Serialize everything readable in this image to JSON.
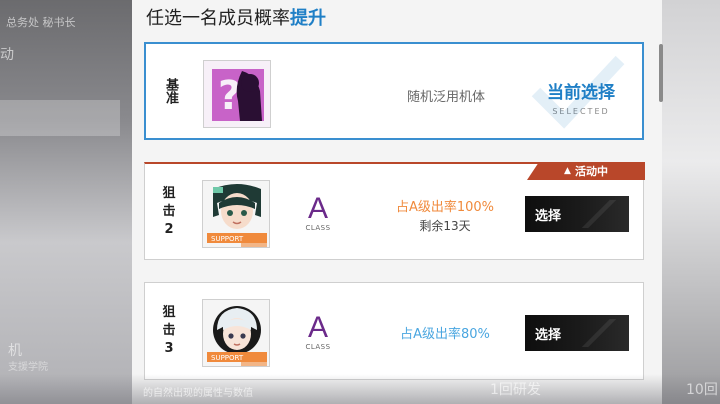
{
  "background": {
    "left_text_1": "总务处 秘书长",
    "left_text_2": "动",
    "left_text_3": "机",
    "left_text_4": "支援学院",
    "bottom_text_1": "的自然出现的属性与数值",
    "bottom_text_2": "1回研发",
    "bottom_text_3": "10回"
  },
  "panel": {
    "title_prefix": "任选一名成员概率",
    "title_highlight": "提升"
  },
  "cards": [
    {
      "tier": "基准",
      "description": "随机泛用机体",
      "status_cn": "当前选择",
      "status_en": "SELECTED"
    },
    {
      "tier": "狙击2",
      "tier_line1": "狙",
      "tier_line2": "击",
      "tier_line3": "2",
      "class_letter": "A",
      "class_label": "CLASS",
      "rate_text": "占A级出率100%",
      "remaining": "剩余13天",
      "badge_text": "活动中",
      "button": "选择"
    },
    {
      "tier_line1": "狙",
      "tier_line2": "击",
      "tier_line3": "3",
      "class_letter": "A",
      "class_label": "CLASS",
      "rate_text": "占A级出率80%",
      "button": "选择"
    }
  ],
  "colors": {
    "accent_blue": "#1f7fc6",
    "event_red": "#b9472a",
    "rate_orange": "#f08a3c",
    "rate_blue": "#4aa6e0",
    "class_purple": "#6b2a8a"
  }
}
